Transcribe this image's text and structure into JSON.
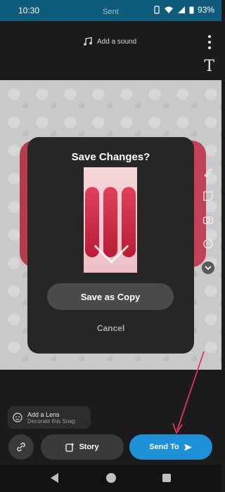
{
  "status_bar": {
    "time": "10:30",
    "ghost_text": "Sent",
    "battery": "93%"
  },
  "toolbar": {
    "sound_label": "Add a sound",
    "text_tool_glyph": "T"
  },
  "dialog": {
    "title": "Save Changes?",
    "save_copy_label": "Save as Copy",
    "cancel_label": "Cancel"
  },
  "lens": {
    "title": "Add a Lens",
    "subtitle": "Decorate this Snap"
  },
  "bottom": {
    "story_label": "Story",
    "send_label": "Send To"
  },
  "colors": {
    "status_bar": "#0f5b7c",
    "send_button": "#1f8fd6",
    "annotation_arrow": "#e0365a"
  },
  "icons": [
    "music-note-icon",
    "more-vertical-icon",
    "text-icon",
    "pen-icon",
    "sticker-icon",
    "camera-icon",
    "face-icon",
    "chevron-down-icon",
    "lens-icon",
    "link-icon",
    "story-add-icon",
    "send-arrow-icon"
  ]
}
